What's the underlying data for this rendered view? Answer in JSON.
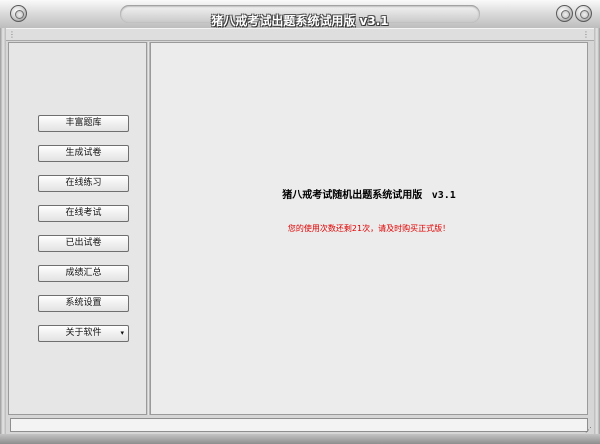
{
  "window": {
    "title": "猪八戒考试出题系统试用版 v3.1"
  },
  "sidebar": {
    "items": [
      {
        "label": "丰富题库"
      },
      {
        "label": "生成试卷"
      },
      {
        "label": "在线练习"
      },
      {
        "label": "在线考试"
      },
      {
        "label": "已出试卷"
      },
      {
        "label": "成绩汇总"
      },
      {
        "label": "系统设置"
      },
      {
        "label": "关于软件",
        "arrow": "▾"
      }
    ]
  },
  "main": {
    "title": "猪八戒考试随机出题系统试用版",
    "version": "v3.1",
    "notice": "您的使用次数还剩21次，请及时购买正式版！",
    "notice_color": "#e00000"
  },
  "icons": {
    "window_menu": "circle-button-icon",
    "minimize": "circle-button-icon",
    "maximize": "circle-button-icon",
    "grip": "grip-icon",
    "resize": "resize-grip-icon"
  }
}
